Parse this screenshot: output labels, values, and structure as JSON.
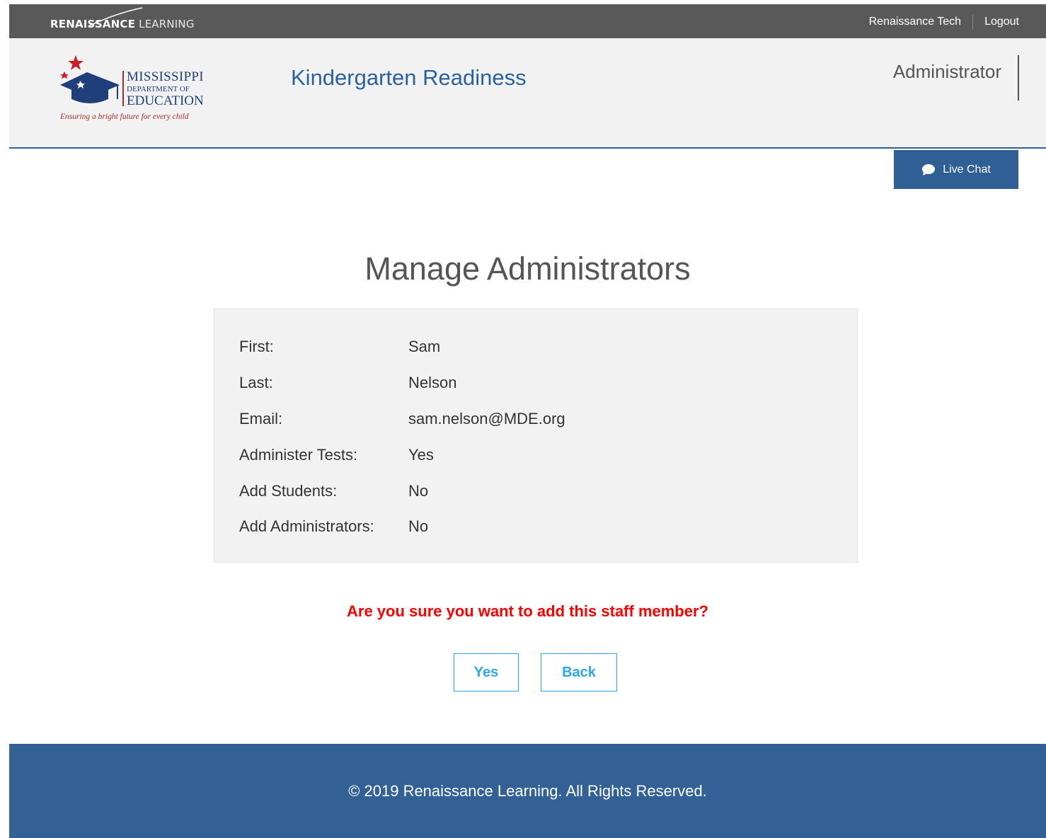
{
  "topbar": {
    "brand_bold": "RENAISSANCE",
    "brand_light": "LEARNING",
    "user_link": "Renaissance Tech",
    "logout_link": "Logout"
  },
  "header": {
    "logo": {
      "line1": "MISSISSIPPI",
      "line2": "DEPARTMENT OF",
      "line3": "EDUCATION",
      "tagline": "Ensuring a bright future for every child"
    },
    "app_title": "Kindergarten Readiness",
    "role": "Administrator"
  },
  "live_chat": {
    "label": "Live Chat",
    "icon": "chat-bubble-icon"
  },
  "page": {
    "title": "Manage Administrators",
    "details": [
      {
        "label": "First:",
        "value": "Sam"
      },
      {
        "label": "Last:",
        "value": "Nelson"
      },
      {
        "label": "Email:",
        "value": "sam.nelson@MDE.org"
      },
      {
        "label": "Administer Tests:",
        "value": "Yes"
      },
      {
        "label": "Add Students:",
        "value": "No"
      },
      {
        "label": "Add Administrators:",
        "value": "No"
      }
    ],
    "confirm_message": "Are you sure you want to add this staff member?",
    "yes_label": "Yes",
    "back_label": "Back"
  },
  "footer": {
    "copyright": "© 2019 Renaissance Learning. All Rights Reserved."
  },
  "colors": {
    "topbar": "#595959",
    "accent_blue": "#2f5f95",
    "button_blue": "#2aa7e6",
    "warning_red": "#ff0000"
  }
}
